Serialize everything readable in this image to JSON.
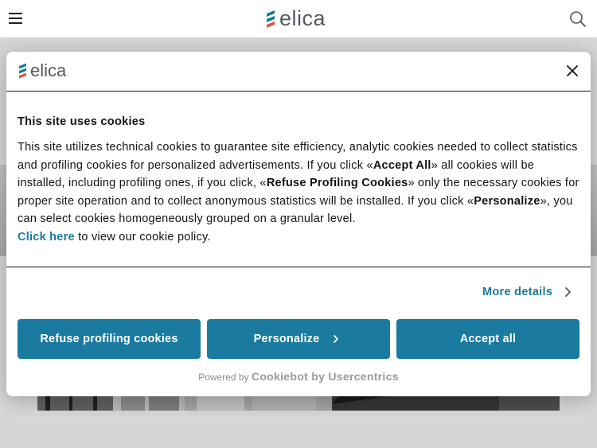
{
  "header": {
    "logo_text": "elica",
    "menu_icon": "hamburger-menu-icon",
    "search_icon": "search-icon"
  },
  "cookie_dialog": {
    "logo_text": "elica",
    "close_icon": "close-icon",
    "title": "This site uses cookies",
    "text_p1": "This site utilizes technical cookies to guarantee site efficiency, analytic cookies needed to collect statistics and profiling cookies for personalized advertisements. If you click «",
    "accept_all_ref": "Accept All",
    "text_p2": "» all cookies will be installed, including profiling ones, if you click, «",
    "refuse_ref": "Refuse Profiling Cookies",
    "text_p3": "» only the necessary cookies for proper site operation and to collect anonymous statistics will be installed. If you click «",
    "personalize_ref": "Personalize",
    "text_p4": "», you can select cookies homogeneously grouped on a granular level.",
    "policy_link": "Click here",
    "policy_suffix": " to view our cookie policy.",
    "more_details": "More details",
    "buttons": {
      "refuse": "Refuse profiling cookies",
      "personalize": "Personalize",
      "accept": "Accept all"
    },
    "powered_by": "Powered by",
    "powered_brand": "Cookiebot by Usercentrics"
  },
  "colors": {
    "accent": "#1a7aa0",
    "logo_blue": "#1a7aa0",
    "logo_red": "#e0533d",
    "text": "#141414"
  }
}
